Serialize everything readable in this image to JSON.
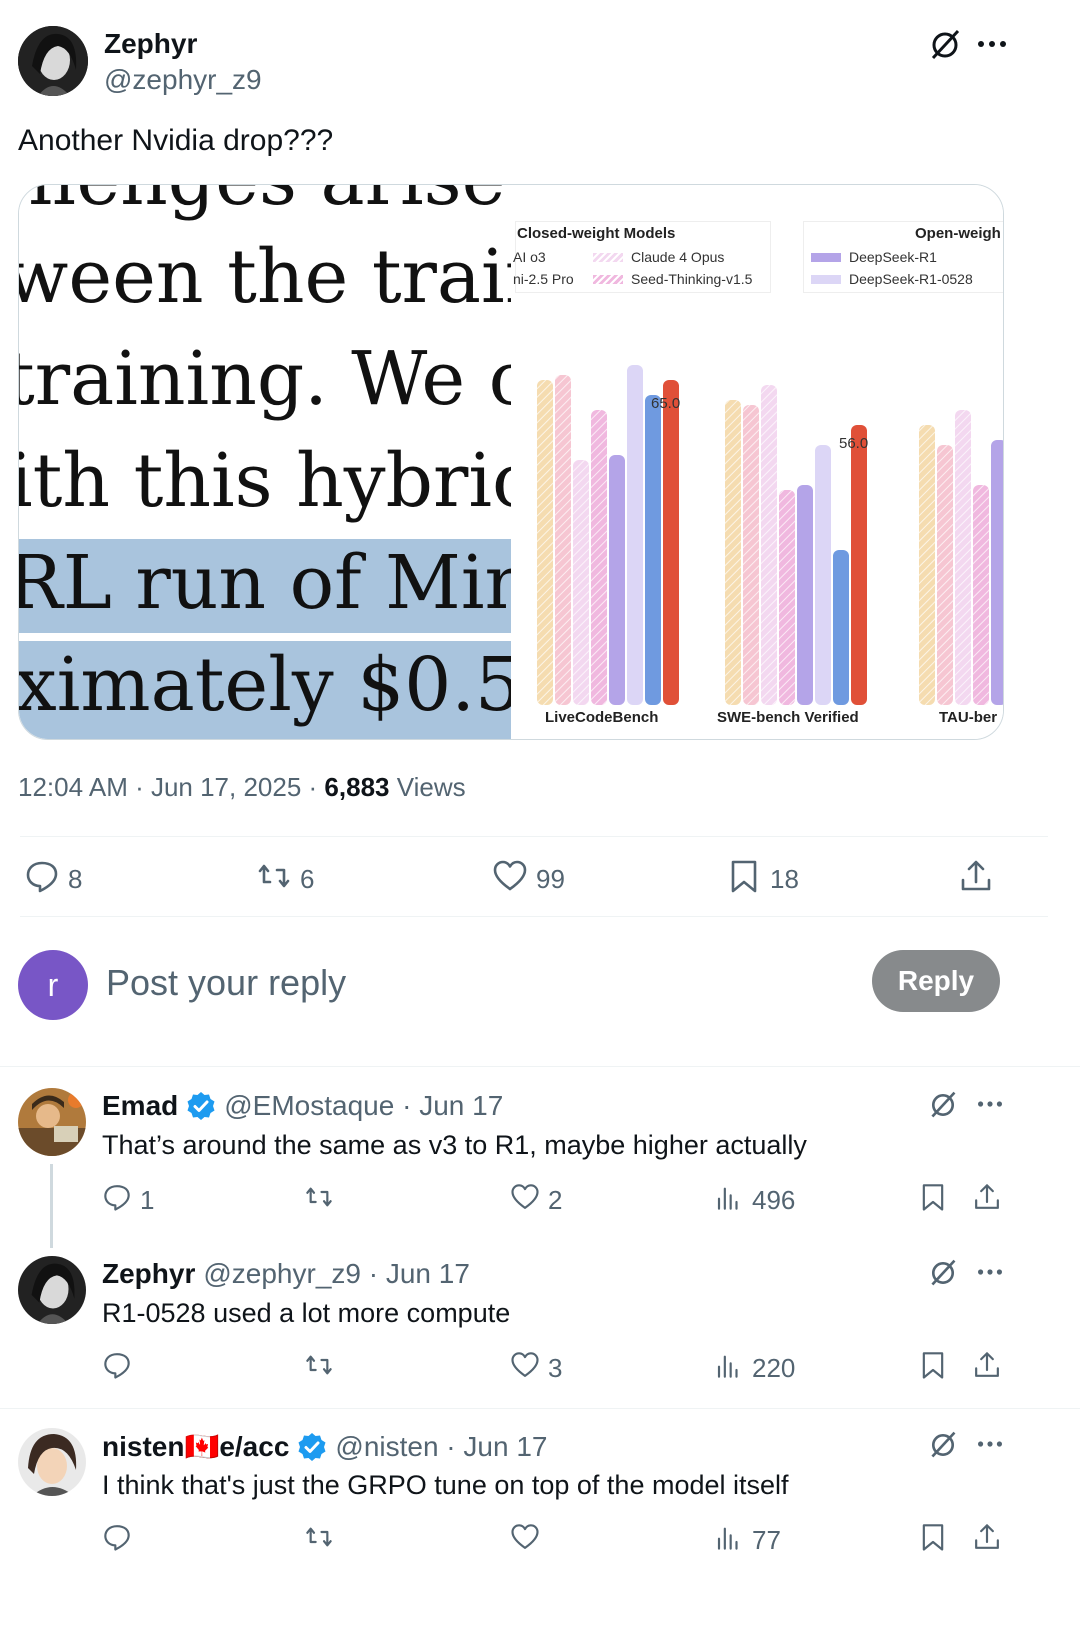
{
  "post": {
    "author_name": "Zephyr",
    "author_handle": "@zephyr_z9",
    "text": "Another Nvidia drop???",
    "timestamp": "12:04 AM · Jun 17, 2025 · ",
    "views_count": "6,883",
    "views_label": " Views",
    "stats": {
      "replies": "8",
      "reposts": "6",
      "likes": "99",
      "bookmarks": "18"
    }
  },
  "media": {
    "left_lines": [
      "llenges arise w",
      "ween the traini",
      "training. We c",
      "ith this hybric",
      "RL run of Min",
      "ximately $0.5"
    ],
    "chart": {
      "legend_closed_title": "Closed-weight Models",
      "legend_open_title": "Open-weigh",
      "legend_items": [
        "AI o3",
        "ni-2.5 Pro",
        "Claude 4 Opus",
        "Seed-Thinking-v1.5",
        "DeepSeek-R1",
        "DeepSeek-R1-0528"
      ],
      "annotations": [
        "65.0",
        "56.0"
      ],
      "categories": [
        "LiveCodeBench",
        "SWE-bench Verified",
        "TAU-ber"
      ]
    }
  },
  "chart_data": {
    "type": "bar",
    "categories": [
      "LiveCodeBench",
      "SWE-bench Verified",
      "TAU-ber"
    ],
    "series_colors": [
      "#f5dcb0",
      "#f6c6d2",
      "#f3d8f0",
      "#f0b8df",
      "#b4a4e8",
      "#dcd6f6",
      "#6f9ae0",
      "#e05038"
    ],
    "values": [
      [
        65,
        66,
        49,
        59,
        50,
        68,
        62,
        65.0
      ],
      [
        61,
        60,
        64,
        43,
        44,
        52,
        31,
        56.0
      ],
      [
        56,
        52,
        59,
        44,
        53,
        null,
        null,
        null
      ]
    ],
    "annotations": [
      "65.0",
      "56.0"
    ],
    "ylim": [
      0,
      80
    ]
  },
  "reply_box": {
    "avatar_letter": "r",
    "placeholder": "Post your reply",
    "button": "Reply"
  },
  "replies": [
    {
      "name": "Emad",
      "verified": true,
      "handle_date": "@EMostaque · Jun 17",
      "text": "That’s around the same as v3 to R1, maybe higher actually",
      "replies": "1",
      "reposts": "",
      "likes": "2",
      "views": "496"
    },
    {
      "name": "Zephyr",
      "verified": false,
      "handle_date": "@zephyr_z9 · Jun 17",
      "text": "R1-0528 used a lot more compute",
      "replies": "",
      "reposts": "",
      "likes": "3",
      "views": "220"
    },
    {
      "name": "nisten🇨🇦e/acc",
      "verified": true,
      "handle_date": "@nisten · Jun 17",
      "text": "I think that's just the GRPO tune on top of the model itself",
      "replies": "",
      "reposts": "",
      "likes": "",
      "views": "77"
    }
  ],
  "icons": [
    "grok-icon",
    "more-icon",
    "reply-icon",
    "repost-icon",
    "like-icon",
    "bookmark-icon",
    "share-icon",
    "views-icon",
    "verified-icon"
  ],
  "colors": {
    "verified": "#1d9bf0",
    "reply_avatar": "#7856c6",
    "reply_button": "#878a8c",
    "muted": "#536471"
  }
}
